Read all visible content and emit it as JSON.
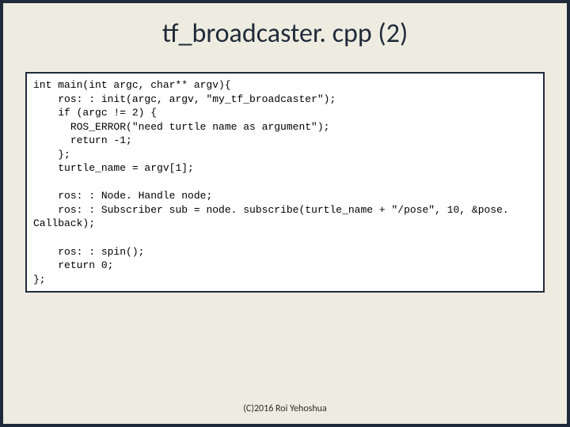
{
  "title": "tf_broadcaster. cpp (2)",
  "code": "int main(int argc, char** argv){\n    ros: : init(argc, argv, \"my_tf_broadcaster\");\n    if (argc != 2) {\n      ROS_ERROR(\"need turtle name as argument\");\n      return -1;\n    };\n    turtle_name = argv[1];\n\n    ros: : Node. Handle node;\n    ros: : Subscriber sub = node. subscribe(turtle_name + \"/pose\", 10, &pose. Callback);\n\n    ros: : spin();\n    return 0;\n};",
  "footer": "(C)2016 Roi Yehoshua"
}
